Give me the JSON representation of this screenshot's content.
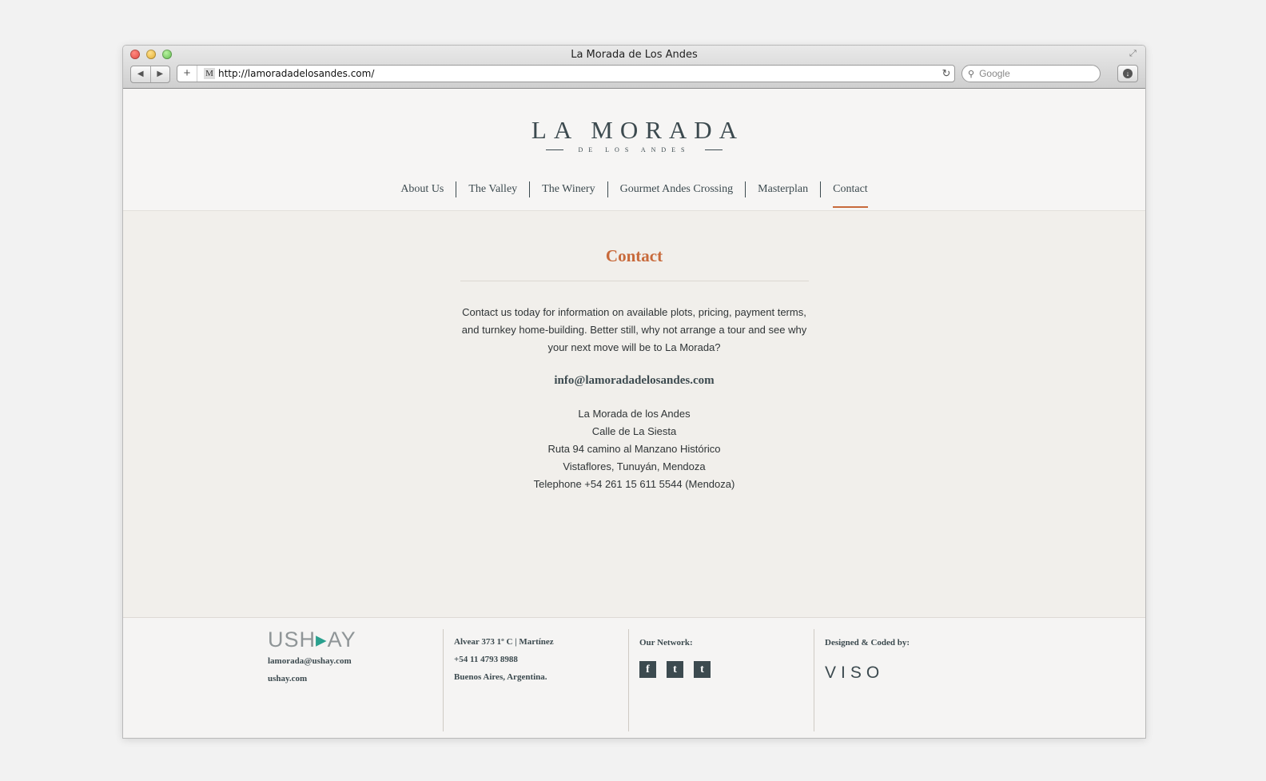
{
  "window": {
    "title": "La Morada de Los Andes",
    "address_url": "http://lamoradadelosandes.com/",
    "favicon_letter": "M",
    "search_placeholder": "Google",
    "back_icon": "◀",
    "forward_icon": "▶",
    "plus_icon": "+",
    "reload_icon": "↻",
    "fullscreen_icon": "⤢",
    "search_icon": "⚲",
    "downloads_icon": "↓"
  },
  "header": {
    "logo_main": "LA MORADA",
    "logo_sub": "DE LOS ANDES",
    "nav": [
      {
        "label": "About Us"
      },
      {
        "label": "The Valley"
      },
      {
        "label": "The Winery"
      },
      {
        "label": "Gourmet Andes Crossing"
      },
      {
        "label": "Masterplan"
      },
      {
        "label": "Contact",
        "active": true
      }
    ]
  },
  "content": {
    "title": "Contact",
    "intro": "Contact us today for information on available plots, pricing, payment terms, and turnkey home-building. Better still, why not arrange a tour and see why your next move will be to La Morada?",
    "email": "info@lamoradadelosandes.com",
    "address": [
      "La Morada de los Andes",
      "Calle de La Siesta",
      "Ruta 94 camino al Manzano Histórico",
      "Vistaflores, Tunuyán, Mendoza",
      "Telephone +54 261 15 611 5544 (Mendoza)"
    ]
  },
  "footer": {
    "ushay_logo_left": "USH",
    "ushay_logo_mark": "▸",
    "ushay_logo_right": "AY",
    "ushay_email": "lamorada@ushay.com",
    "ushay_site": "ushay.com",
    "address_lines": [
      "Alvear 373 1º C | Martínez",
      "+54 11 4793 8988",
      "Buenos Aires, Argentina."
    ],
    "network_heading": "Our Network:",
    "social": [
      {
        "name": "facebook-icon",
        "glyph": "f"
      },
      {
        "name": "twitter-icon",
        "glyph": "t"
      },
      {
        "name": "tumblr-icon",
        "glyph": "t"
      }
    ],
    "designed_heading": "Designed & Coded by:",
    "designer_logo": "VISO"
  },
  "colors": {
    "accent": "#c86a3b",
    "text_dark": "#3c4a4f",
    "ushay_teal": "#2aa08e"
  }
}
